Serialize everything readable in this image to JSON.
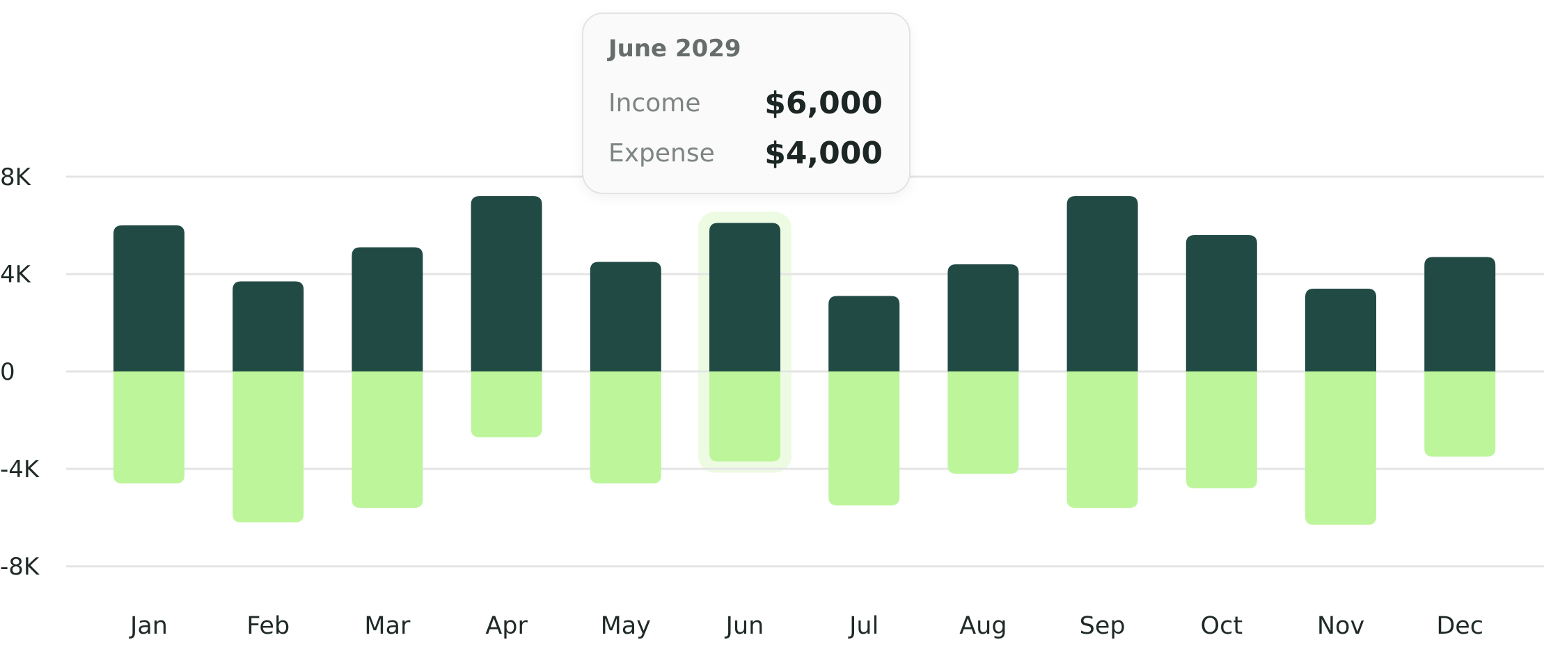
{
  "chart_data": {
    "type": "bar",
    "categories": [
      "Jan",
      "Feb",
      "Mar",
      "Apr",
      "May",
      "Jun",
      "Jul",
      "Aug",
      "Sep",
      "Oct",
      "Nov",
      "Dec"
    ],
    "series": [
      {
        "name": "Income",
        "color": "#214a45",
        "values": [
          6000,
          3700,
          5100,
          7200,
          4500,
          6100,
          3100,
          4400,
          7200,
          5600,
          3400,
          4700
        ]
      },
      {
        "name": "Expense",
        "color": "#bdf59b",
        "values": [
          -4600,
          -6200,
          -5600,
          -2700,
          -4600,
          -3700,
          -5500,
          -4200,
          -5600,
          -4800,
          -6300,
          -3500
        ]
      }
    ],
    "yticks": [
      {
        "value": 8000,
        "label": "8K"
      },
      {
        "value": 4000,
        "label": "4K"
      },
      {
        "value": 0,
        "label": "0"
      },
      {
        "value": -4000,
        "label": "-4K"
      },
      {
        "value": -8000,
        "label": "-8K"
      }
    ],
    "ylim": [
      -8000,
      8000
    ],
    "grid": true,
    "highlight": {
      "category": "Jun",
      "color": "#eefbe3"
    }
  },
  "tooltip": {
    "title": "June 2029",
    "rows": [
      {
        "label": "Income",
        "value": "$6,000"
      },
      {
        "label": "Expense",
        "value": "$4,000"
      }
    ]
  }
}
